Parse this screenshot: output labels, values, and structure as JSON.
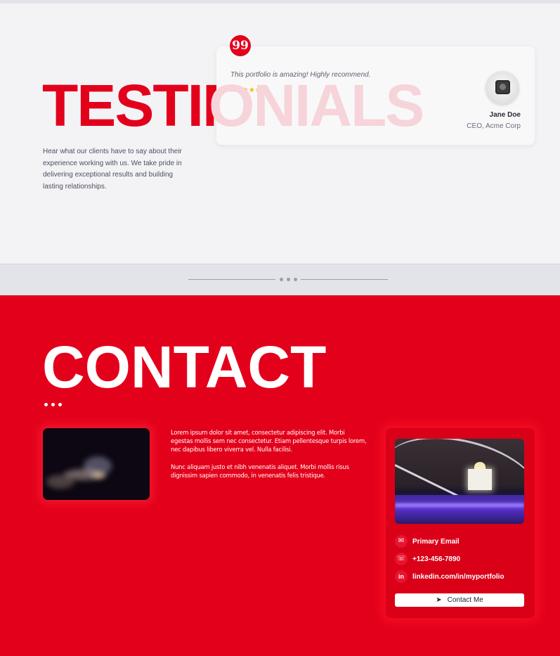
{
  "testimonials": {
    "heading_part1": "TESTIM",
    "heading_part2": "ONIALS",
    "description": "Hear what our clients have to say about their experience working with us. We take pride in delivering exceptional results and building lasting relationships.",
    "card": {
      "quote_glyph": "99",
      "quote": "This portfolio is amazing! Highly recommend.",
      "rating": 5,
      "stars": "★★★★★",
      "name": "Jane Doe",
      "role": "CEO, Acme Corp"
    }
  },
  "contact": {
    "heading": "CONTACT",
    "paragraphs": [
      "Lorem ipsum dolor sit amet, consectetur adipiscing elit. Morbi egestas mollis sem nec consectetur. Etiam pellentesque turpis lorem, nec dapibus libero viverra vel. Nulla facilisi.",
      "Nunc aliquam justo et nibh venenatis aliquet. Morbi mollis risus dignissim sapien commodo, in venenatis felis tristique."
    ],
    "email_label": "Primary Email",
    "phone": "+123-456-7890",
    "linkedin": "linkedin.com/in/myportfolio",
    "button_label": "Contact Me"
  },
  "colors": {
    "accent": "#e3001b",
    "stars": "#f5b800"
  },
  "icons": [
    "quote-icon",
    "star-icon",
    "mail-icon",
    "phone-icon",
    "linkedin-icon",
    "send-icon"
  ]
}
